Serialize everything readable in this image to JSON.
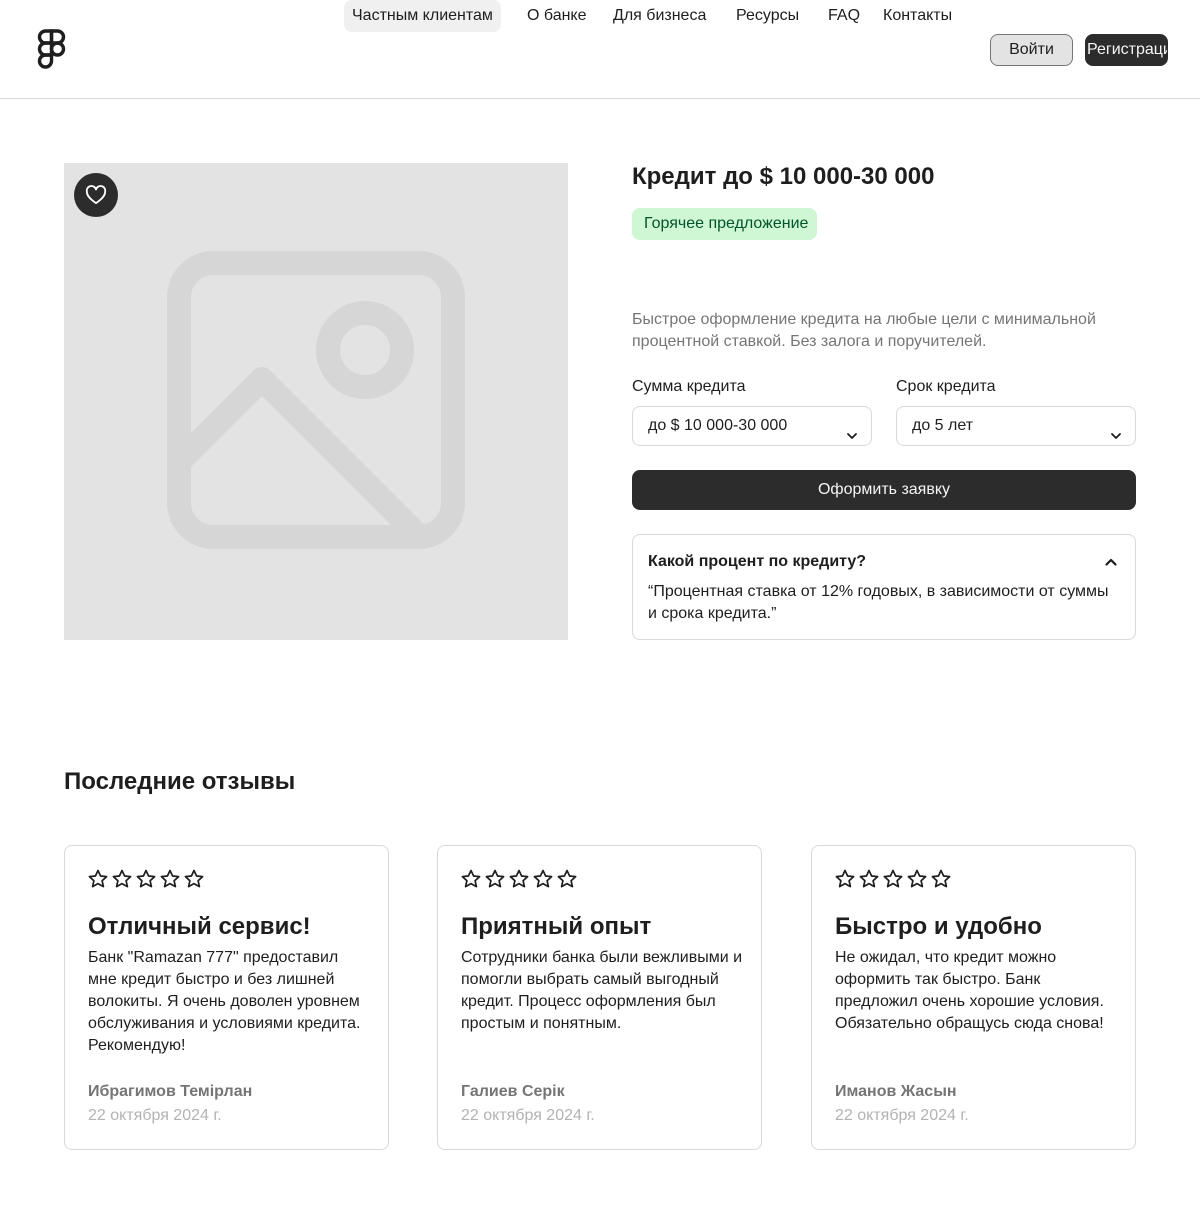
{
  "header": {
    "logo_icon": "figma-logo-icon",
    "nav": [
      {
        "label": "Частным клиентам",
        "active": true
      },
      {
        "label": "О банке",
        "active": false
      },
      {
        "label": "Для бизнеса",
        "active": false
      },
      {
        "label": "Ресурсы",
        "active": false
      },
      {
        "label": "FAQ",
        "active": false
      },
      {
        "label": "Контакты",
        "active": false
      }
    ],
    "login_label": "Войти",
    "register_label": "Регистрация"
  },
  "product": {
    "image_icon": "image-placeholder-icon",
    "favorite_icon": "heart-icon",
    "title": "Кредит до $ 10 000-30 000",
    "tag": "Горячее предложение",
    "description": "Быстрое оформление кредита на любые цели с минимальной процентной ставкой. Без залога и поручителей.",
    "amount": {
      "label": "Сумма кредита",
      "value": "до $ 10 000-30 000"
    },
    "term": {
      "label": "Срок кредита",
      "value": "до 5 лет"
    },
    "apply_label": "Оформить заявку",
    "faq": {
      "question": "Какой процент по кредиту?",
      "answer": "“Процентная ставка от 12% годовых, в зависимости от суммы и срока кредита.”",
      "expanded": true
    }
  },
  "reviews": {
    "title": "Последние отзывы",
    "items": [
      {
        "stars": 5,
        "title": "Отличный сервис!",
        "text": "Банк \"Ramazan 777\" предоставил мне кредит быстро и без лишней волокиты. Я очень доволен уровнем обслуживания и условиями кредита. Рекомендую!",
        "author": "Ибрагимов Темірлан",
        "date": "22 октября 2024 г."
      },
      {
        "stars": 5,
        "title": "Приятный опыт",
        "text": "Сотрудники банка были вежливыми и помогли выбрать самый выгодный кредит. Процесс оформления был простым и понятным.",
        "author": "Галиев Серік",
        "date": "22 октября 2024 г."
      },
      {
        "stars": 5,
        "title": "Быстро и удобно",
        "text": "Не ожидал, что кредит можно оформить так быстро. Банк предложил очень хорошие условия. Обязательно обращусь сюда снова!",
        "author": "Иманов Жасын",
        "date": "22 октября 2024 г."
      }
    ]
  },
  "colors": {
    "primary": "#2c2c2c",
    "tag_bg": "#cff7d3",
    "tag_text": "#02542d",
    "border": "#d9d9d9",
    "muted_text": "#757575"
  }
}
